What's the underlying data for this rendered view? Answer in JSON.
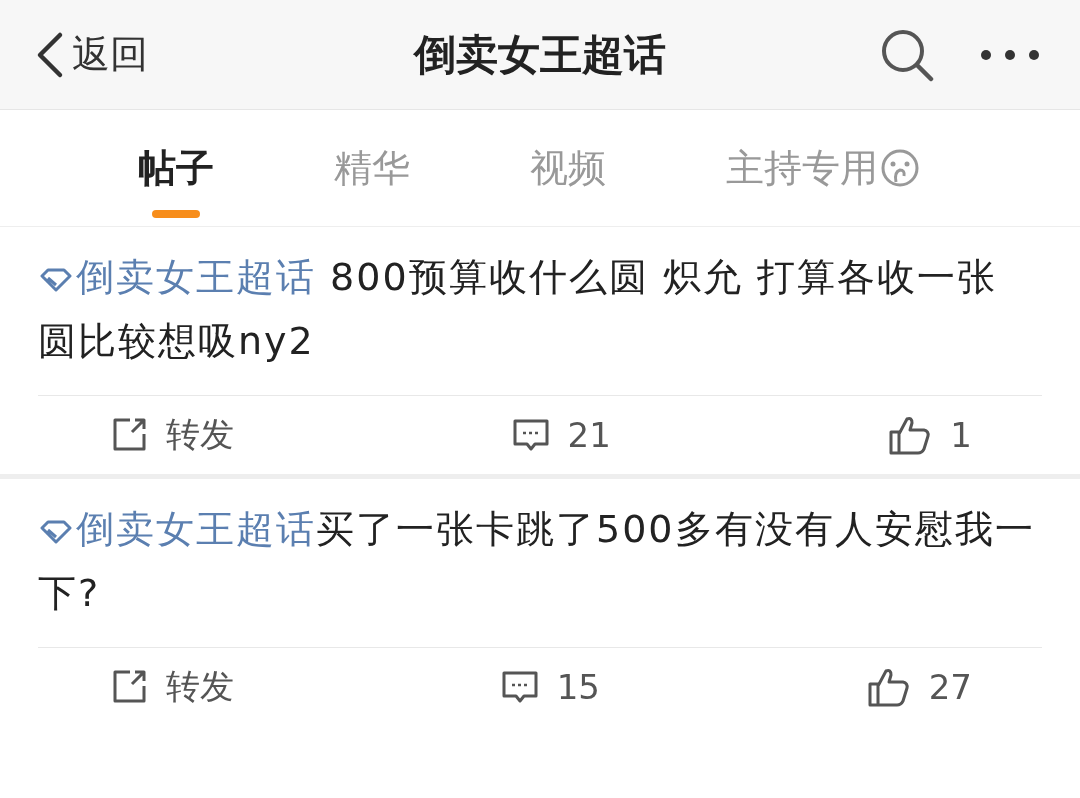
{
  "nav_bar": {
    "back": "返回",
    "title": "倒卖女王超话"
  },
  "tabs": [
    {
      "label": "帖子",
      "selected": true,
      "icon": false
    },
    {
      "label": "精华",
      "selected": false,
      "icon": false
    },
    {
      "label": "视频",
      "selected": false,
      "icon": false
    },
    {
      "label": "主持专用",
      "selected": false,
      "icon": true
    }
  ],
  "posts": [
    {
      "topic": "倒卖女王超话",
      "lines": [
        " 800预算收什么圆 炽允 打算各收一张",
        "圆比较想吸ny2"
      ],
      "repost": "转发",
      "comments": "21",
      "likes": "1"
    },
    {
      "topic": "倒卖女王超话",
      "lines": [
        "买了一张卡跳了500多有没有人安慰我一下?"
      ],
      "repost": "转发",
      "comments": "15",
      "likes": "27"
    }
  ]
}
